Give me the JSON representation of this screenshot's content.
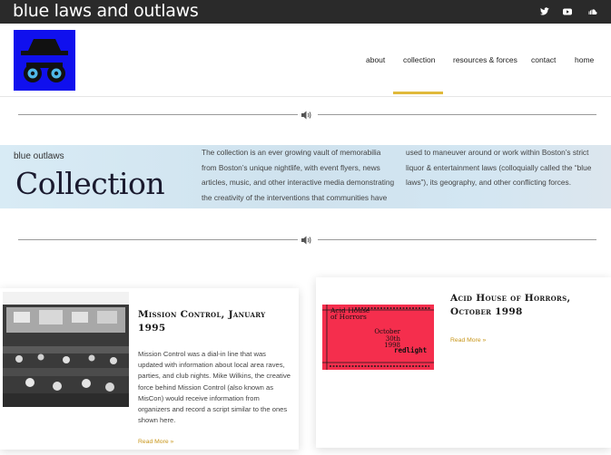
{
  "site": {
    "title": "blue laws and outlaws"
  },
  "nav": {
    "items": [
      "about",
      "collection",
      "resources & forces",
      "contact",
      "home"
    ],
    "active": "collection"
  },
  "social": {
    "icons": [
      "twitter-icon",
      "youtube-icon",
      "soundcloud-icon"
    ]
  },
  "banner": {
    "eyebrow": "blue outlaws",
    "title": "Collection",
    "col1": [
      "The collection is an ever growing vault of memorabilia",
      "from Boston’s unique nightlife, with event flyers, news",
      "articles, music, and other interactive media demonstrating",
      "the creativity of the interventions that communities have"
    ],
    "col2": [
      "used to maneuver around or work within Boston’s strict",
      "liquor & entertainment laws (colloquially called the “blue",
      "laws”), its geography, and other conflicting forces."
    ]
  },
  "cards": [
    {
      "title": [
        "Mission Control, January",
        "1995"
      ],
      "description": [
        "Mission Control was a dial-in line that was",
        "updated with information about local area raves,",
        "parties, and club nights. Mike Wilkins, the creative",
        "force behind Mission Control (also known as",
        "MisCon) would receive information from",
        "organizers and record a script similar to the ones",
        "shown here."
      ],
      "read_more": "Read More »"
    },
    {
      "title": [
        "Acid House of Horrors,",
        "October 1998"
      ],
      "read_more": "Read More »",
      "flyer": {
        "headline": [
          "Acid House",
          "of Horrors"
        ],
        "date": [
          "October",
          "30th 1998"
        ],
        "venue": "redlight"
      }
    }
  ],
  "colors": {
    "topbar": "#2a2a2a",
    "logo_bg": "#1010ee",
    "accent": "#e0b93a",
    "flyer": "#f52e4d"
  }
}
